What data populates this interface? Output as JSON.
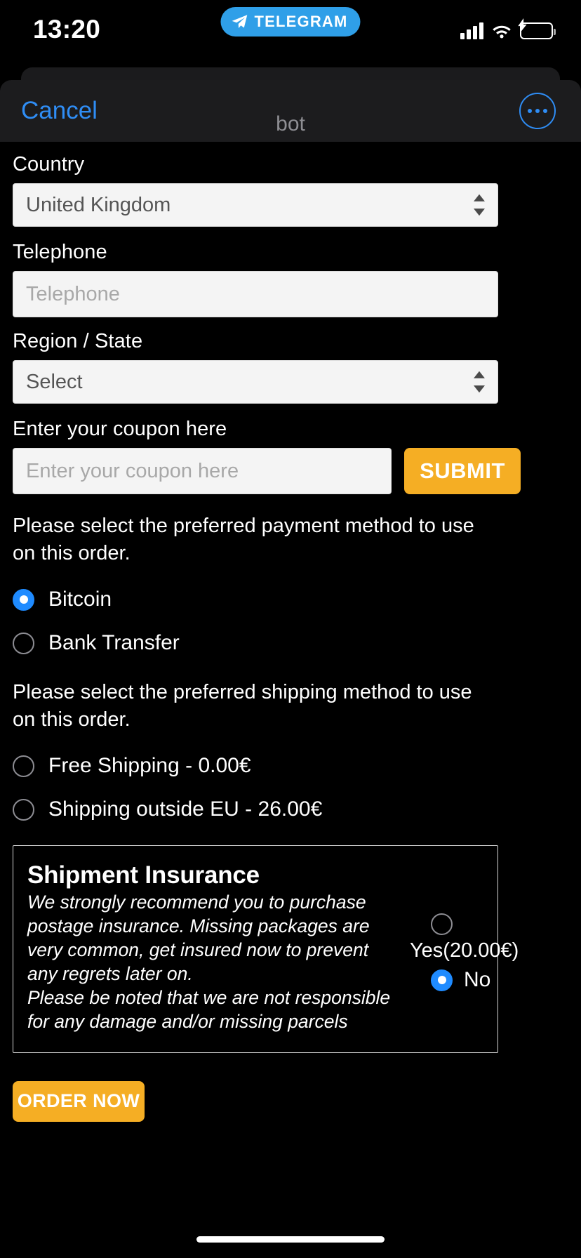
{
  "status_bar": {
    "time": "13:20",
    "app_pill_label": "TELEGRAM",
    "icons": {
      "plane": "telegram-plane-icon",
      "signal": "cellular-signal-icon",
      "wifi": "wifi-icon",
      "battery": "battery-charging-icon"
    }
  },
  "sheet_header": {
    "cancel_label": "Cancel",
    "title": "bot",
    "more_label": "more-options"
  },
  "form": {
    "country": {
      "label": "Country",
      "value": "United Kingdom"
    },
    "telephone": {
      "label": "Telephone",
      "value": "",
      "placeholder": "Telephone"
    },
    "region": {
      "label": "Region / State",
      "value": "Select"
    },
    "coupon": {
      "label": "Enter your coupon here",
      "value": "",
      "placeholder": "Enter your coupon here",
      "submit_label": "SUBMIT"
    }
  },
  "payment": {
    "instruction": "Please select the preferred payment method to use on this order.",
    "options": [
      {
        "label": "Bitcoin",
        "selected": true
      },
      {
        "label": "Bank Transfer",
        "selected": false
      }
    ]
  },
  "shipping": {
    "instruction": "Please select the preferred shipping method to use on this order.",
    "options": [
      {
        "label": "Free Shipping - 0.00€",
        "selected": false
      },
      {
        "label": "Shipping outside EU - 26.00€",
        "selected": false
      }
    ]
  },
  "insurance": {
    "title": "Shipment Insurance",
    "description_line_1": "We strongly recommend you to purchase postage insurance. Missing packages are very common, get insured now to prevent any regrets later on.",
    "description_line_2": "Please be noted that we are not responsible for any damage and/or missing parcels",
    "options": [
      {
        "label": "Yes(20.00€)",
        "selected": false
      },
      {
        "label": "No",
        "selected": true
      }
    ]
  },
  "order": {
    "button_label": "ORDER NOW"
  },
  "colors": {
    "accent_orange": "#f5ae24",
    "accent_blue": "#1f8bff",
    "link_blue": "#2f8df5",
    "telegram_blue": "#2f9fe8",
    "background": "#000000",
    "sheet_header": "#1c1c1e",
    "input_bg": "#f4f4f4"
  }
}
